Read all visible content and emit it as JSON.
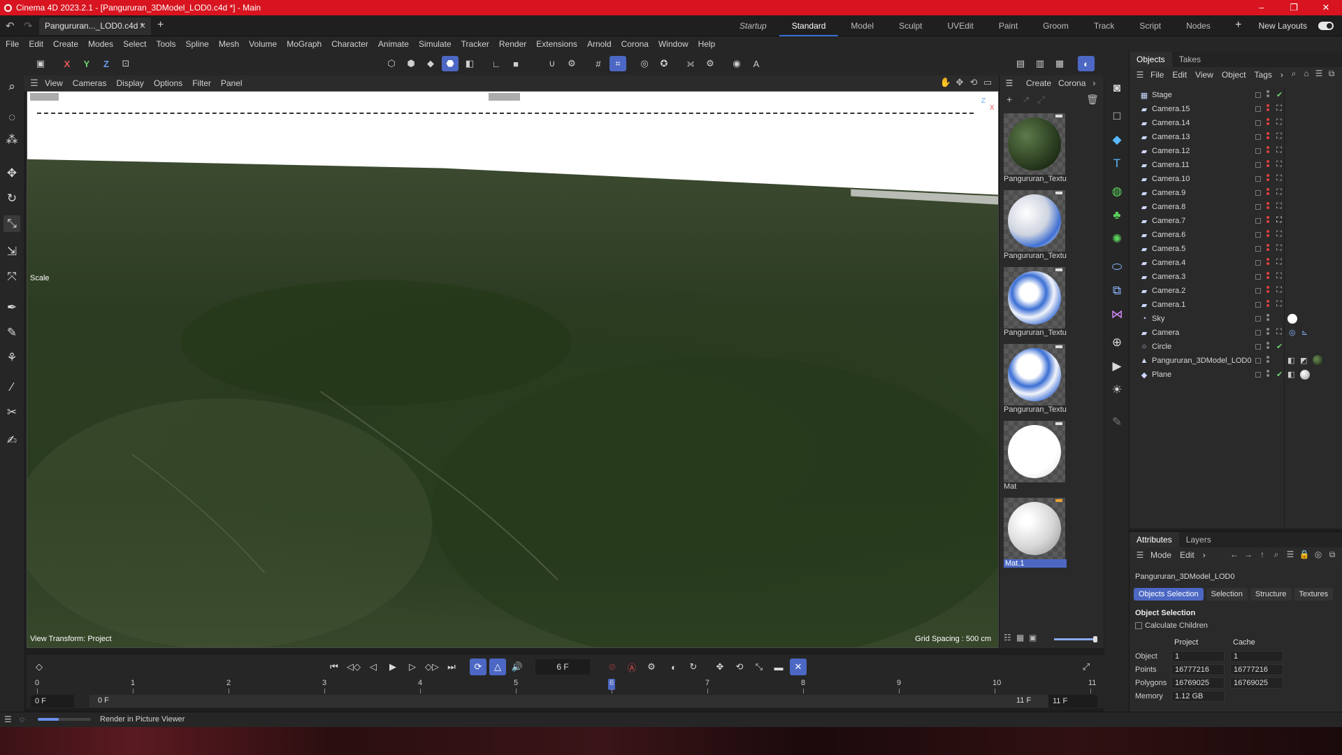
{
  "titlebar": {
    "title": "Cinema 4D 2023.2.1 - [Pangururan_3DModel_LOD0.c4d *] - Main",
    "minimize": "–",
    "restore": "❐",
    "close": "✕"
  },
  "tabbar": {
    "doc_tab": "Pangururan..._LOD0.c4d *",
    "layouts": [
      "Startup",
      "Standard",
      "Model",
      "Sculpt",
      "UVEdit",
      "Paint",
      "Groom",
      "Track",
      "Script",
      "Nodes"
    ],
    "active_layout": "Standard",
    "new_layouts": "New Layouts"
  },
  "menubar": {
    "items": [
      "File",
      "Edit",
      "Create",
      "Modes",
      "Select",
      "Tools",
      "Spline",
      "Mesh",
      "Volume",
      "MoGraph",
      "Character",
      "Animate",
      "Simulate",
      "Tracker",
      "Render",
      "Extensions",
      "Arnold",
      "Corona",
      "Window",
      "Help"
    ]
  },
  "toolbar": {
    "axis_x": "X",
    "axis_y": "Y",
    "axis_z": "Z",
    "letter_a": "A"
  },
  "viewport": {
    "menu": [
      "View",
      "Cameras",
      "Display",
      "Options",
      "Filter",
      "Panel"
    ],
    "scale_label": "Scale",
    "view_transform": "View Transform: Project",
    "grid_spacing": "Grid Spacing : 500 cm",
    "axis_z": "Z",
    "axis_x": "X"
  },
  "materials": {
    "menu": [
      "Create",
      "Corona"
    ],
    "items": [
      {
        "label": "Pangururan_Textu"
      },
      {
        "label": "Pangururan_Textu"
      },
      {
        "label": "Pangururan_Textu"
      },
      {
        "label": "Pangururan_Textu"
      },
      {
        "label": "Mat"
      },
      {
        "label": "Mat.1"
      }
    ]
  },
  "objects": {
    "tabs": [
      "Objects",
      "Takes"
    ],
    "menu": [
      "File",
      "Edit",
      "View",
      "Object",
      "Tags"
    ],
    "items": [
      {
        "name": "Stage"
      },
      {
        "name": "Camera.15"
      },
      {
        "name": "Camera.14"
      },
      {
        "name": "Camera.13"
      },
      {
        "name": "Camera.12"
      },
      {
        "name": "Camera.11"
      },
      {
        "name": "Camera.10"
      },
      {
        "name": "Camera.9"
      },
      {
        "name": "Camera.8"
      },
      {
        "name": "Camera.7"
      },
      {
        "name": "Camera.6"
      },
      {
        "name": "Camera.5"
      },
      {
        "name": "Camera.4"
      },
      {
        "name": "Camera.3"
      },
      {
        "name": "Camera.2"
      },
      {
        "name": "Camera.1"
      },
      {
        "name": "Sky"
      },
      {
        "name": "Camera"
      },
      {
        "name": "Circle"
      },
      {
        "name": "Pangururan_3DModel_LOD0"
      },
      {
        "name": "Plane"
      }
    ]
  },
  "attributes": {
    "tabs": [
      "Attributes",
      "Layers"
    ],
    "menu": [
      "Mode",
      "Edit"
    ],
    "object_name": "Pangururan_3DModel_LOD0",
    "subtabs": [
      "Objects Selection",
      "Selection",
      "Structure",
      "Textures"
    ],
    "section": "Object Selection",
    "calc_children": "Calculate Children",
    "col_project": "Project",
    "col_cache": "Cache",
    "rows": [
      {
        "key": "Object",
        "project": "1",
        "cache": "1"
      },
      {
        "key": "Points",
        "project": "16777216",
        "cache": "16777216"
      },
      {
        "key": "Polygons",
        "project": "16769025",
        "cache": "16769025"
      },
      {
        "key": "Memory",
        "project": "1.12 GB",
        "cache": ""
      }
    ]
  },
  "timeline": {
    "current_frame": "6 F",
    "ruler": [
      "0",
      "1",
      "2",
      "3",
      "4",
      "5",
      "6",
      "7",
      "8",
      "9",
      "10",
      "11"
    ],
    "playhead_frame": 6,
    "range_start": "0 F",
    "range_start2": "0 F",
    "range_end": "11 F",
    "range_end2": "11 F"
  },
  "statusbar": {
    "text": "Render in Picture Viewer",
    "progress": 0.4
  }
}
